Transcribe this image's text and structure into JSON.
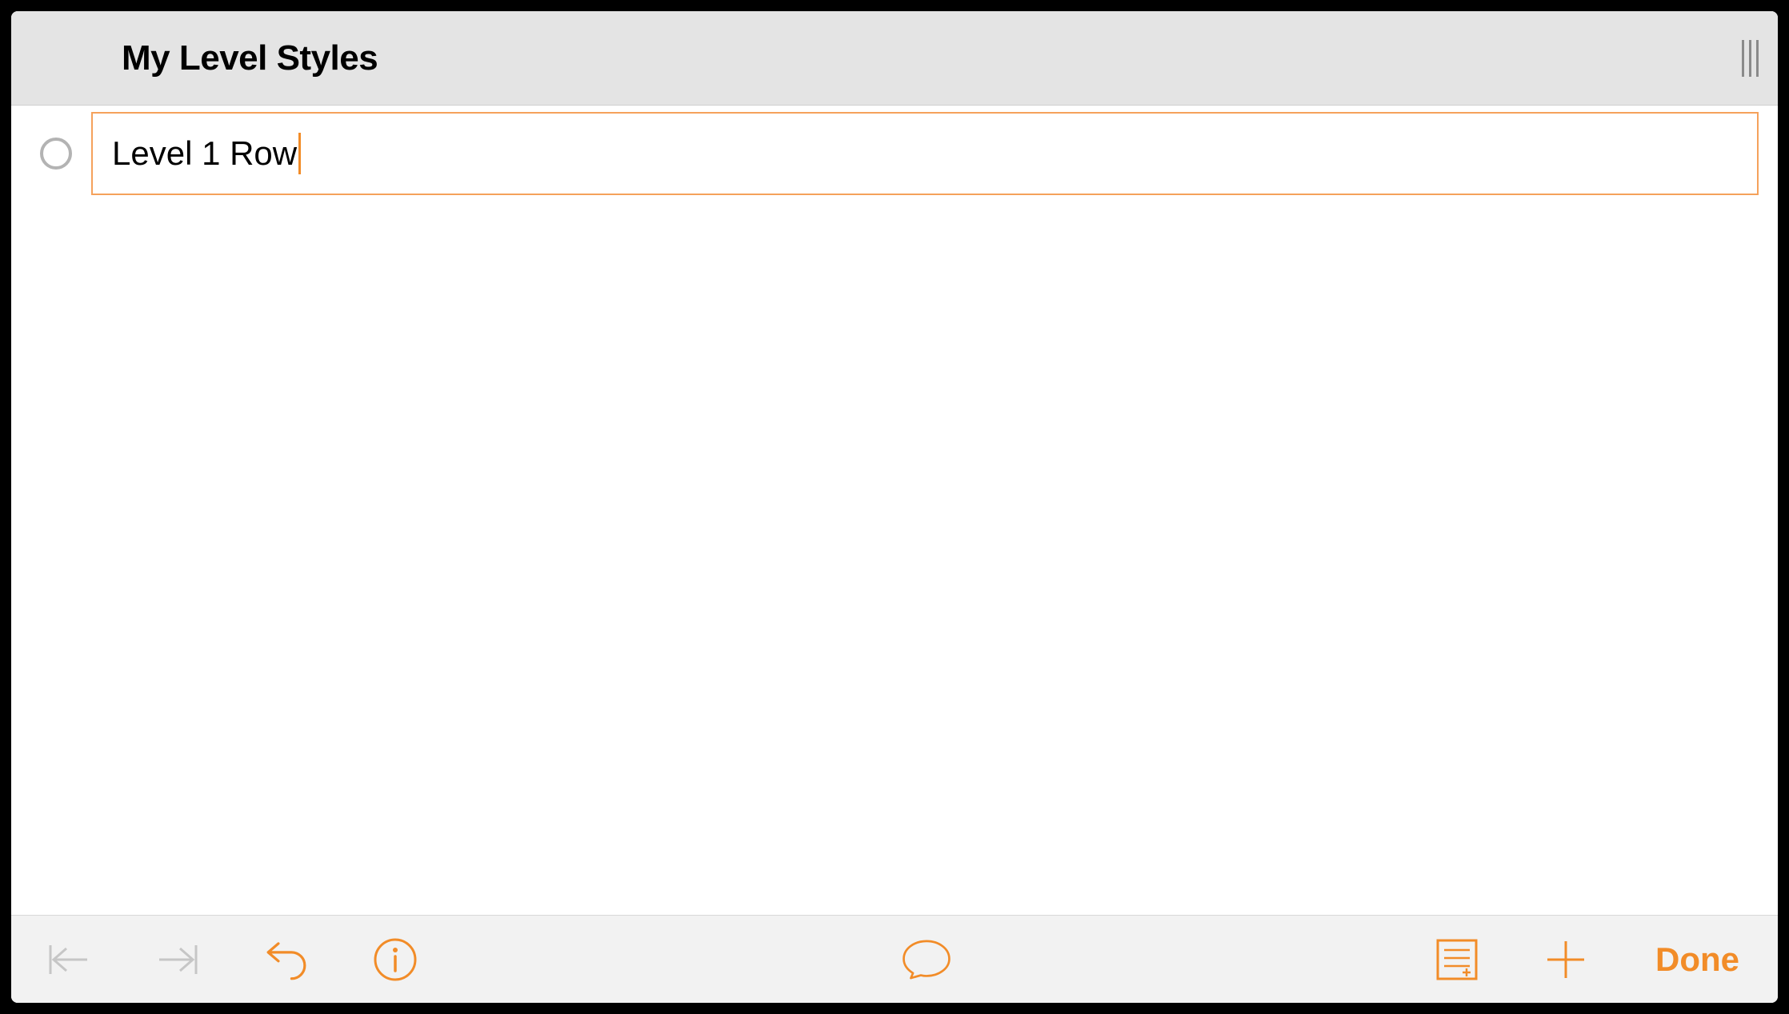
{
  "header": {
    "title": "My Level Styles"
  },
  "content": {
    "rows": [
      {
        "text": "Level 1 Row",
        "editing": true
      }
    ]
  },
  "toolbar": {
    "done_label": "Done"
  },
  "colors": {
    "accent": "#f28c28",
    "accent_border": "#f5a15b",
    "disabled": "#c6c6c6",
    "header_bg": "#e4e4e4",
    "toolbar_bg": "#f2f2f2"
  },
  "icons": {
    "outdent": "outdent-icon",
    "indent": "indent-icon",
    "undo": "undo-icon",
    "info": "info-icon",
    "note": "note-icon",
    "list": "list-icon",
    "add": "add-icon"
  }
}
